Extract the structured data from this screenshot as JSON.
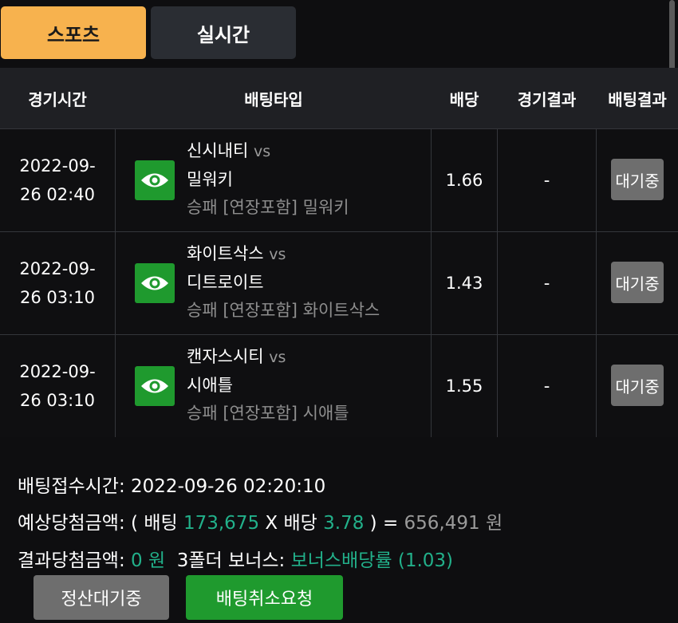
{
  "tabs": {
    "sports": "스포츠",
    "live": "실시간"
  },
  "headers": {
    "time": "경기시간",
    "bet_type": "배팅타입",
    "odds": "배당",
    "game_result": "경기결과",
    "bet_result": "배팅결과"
  },
  "rows": [
    {
      "date": "2022-09-",
      "time": "26 02:40",
      "home": "신시내티",
      "vs": "vs",
      "away": "밀워키",
      "market": "승패 [연장포함] 밀워키",
      "odds": "1.66",
      "result": "-",
      "status": "대기중"
    },
    {
      "date": "2022-09-",
      "time": "26 03:10",
      "home": "화이트삭스",
      "vs": "vs",
      "away": "디트로이트",
      "market": "승패 [연장포함] 화이트삭스",
      "odds": "1.43",
      "result": "-",
      "status": "대기중"
    },
    {
      "date": "2022-09-",
      "time": "26 03:10",
      "home": "캔자스시티",
      "vs": "vs",
      "away": "시애틀",
      "market": "승패 [연장포함] 시애틀",
      "odds": "1.55",
      "result": "-",
      "status": "대기중"
    }
  ],
  "summary": {
    "bet_time_label": "배팅접수시간:",
    "bet_time": "2022-09-26 02:20:10",
    "expected_label": "예상당첨금액:",
    "open_paren": "(",
    "bet_label": "배팅",
    "bet_amount": "173,675",
    "times": "X",
    "odds_label": "배당",
    "total_odds": "3.78",
    "close_eq": ") =",
    "expected_amount": "656,491",
    "won_unit": "원",
    "result_label": "결과당첨금액:",
    "result_amount": "0 원",
    "bonus_label": "3폴더 보너스:",
    "bonus_value": "보너스배당률 (1.03)"
  },
  "buttons": {
    "settle": "정산대기중",
    "cancel": "배팅취소요청"
  },
  "icons": {
    "view": "eye-icon"
  },
  "colors": {
    "accent": "#f7b24e",
    "green": "#1f9a2e",
    "highlight": "#22b08a",
    "pending": "#6e6e6e"
  }
}
